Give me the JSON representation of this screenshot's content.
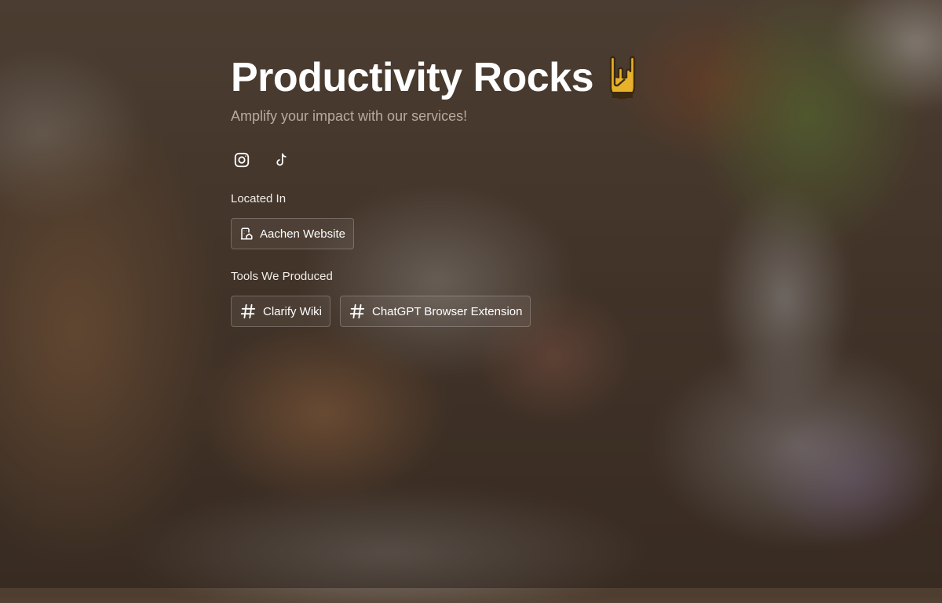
{
  "hero": {
    "title": "Productivity Rocks",
    "title_emoji_icon": "sign-of-the-horns-emoji-icon",
    "subtitle": "Amplify your impact with our services!"
  },
  "socials": [
    {
      "name": "Instagram",
      "icon": "instagram-icon"
    },
    {
      "name": "TikTok",
      "icon": "tiktok-icon"
    }
  ],
  "located": {
    "label": "Located In",
    "items": [
      {
        "label": "Aachen Website",
        "icon": "building-icon"
      }
    ]
  },
  "tools": {
    "label": "Tools We Produced",
    "items": [
      {
        "label": "Clarify Wiki",
        "icon": "hashtag-icon"
      },
      {
        "label": "ChatGPT Browser Extension",
        "icon": "hashtag-icon"
      }
    ]
  },
  "colors": {
    "text": "#ffffff",
    "subtitle": "#b6aba0",
    "emoji_skin": "#e8b12a",
    "emoji_outline": "#3b2a10"
  }
}
